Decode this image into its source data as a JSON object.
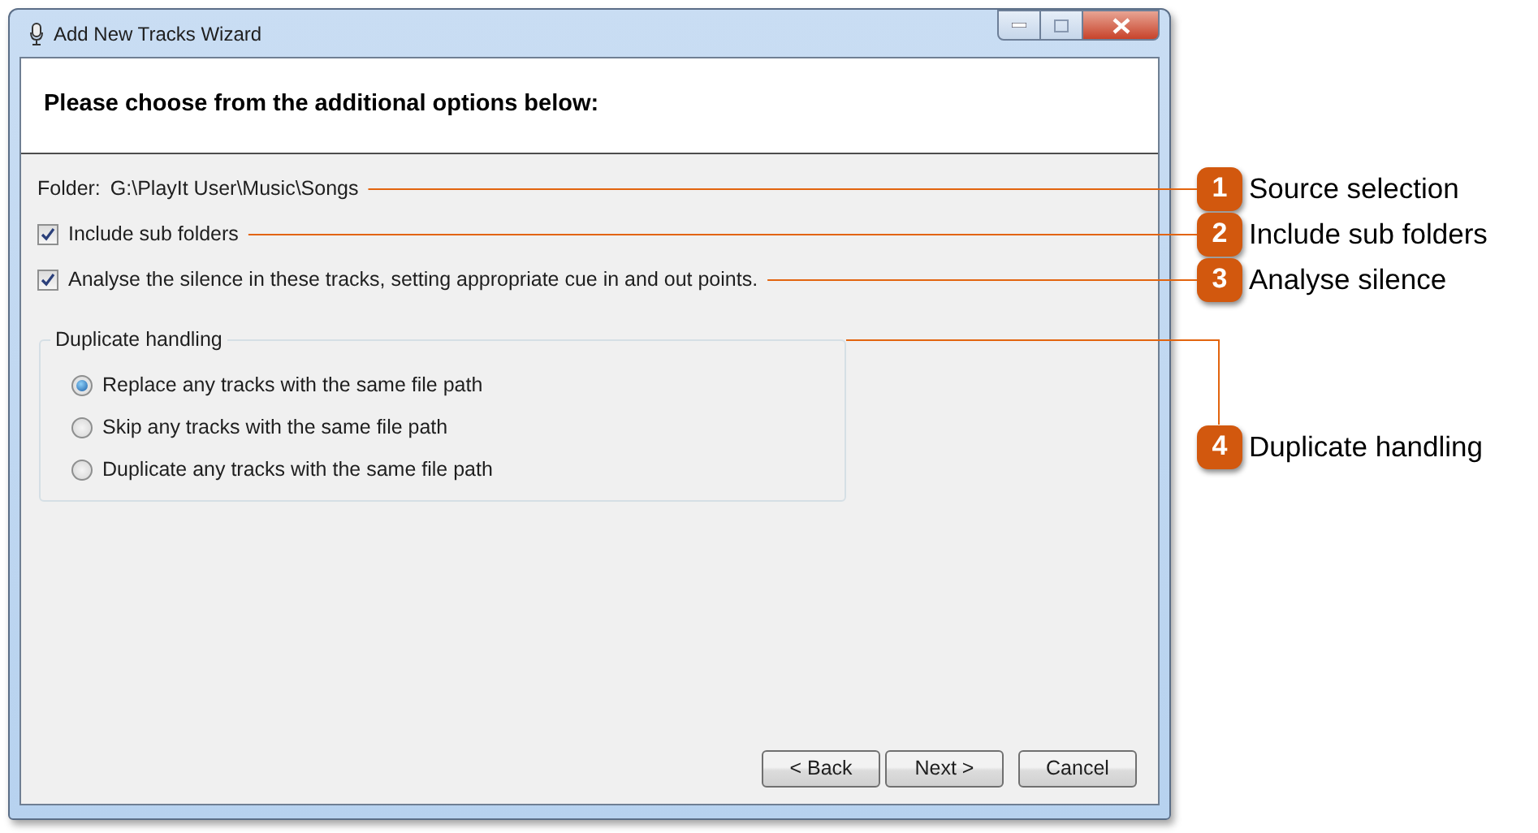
{
  "window": {
    "title": "Add New Tracks Wizard"
  },
  "header": {
    "title": "Please choose from the additional options below:"
  },
  "folder": {
    "label": "Folder:",
    "path": "G:\\PlayIt User\\Music\\Songs"
  },
  "checkboxes": [
    {
      "label": "Include sub folders",
      "checked": true
    },
    {
      "label": "Analyse the silence in these tracks, setting appropriate cue in and out points.",
      "checked": true
    }
  ],
  "duplicate_handling": {
    "title": "Duplicate handling",
    "options": [
      {
        "label": "Replace any tracks with the same file path",
        "selected": true
      },
      {
        "label": "Skip any tracks with the same file path",
        "selected": false
      },
      {
        "label": "Duplicate any tracks with the same file path",
        "selected": false
      }
    ]
  },
  "buttons": [
    {
      "label": "< Back"
    },
    {
      "label": "Next >"
    },
    {
      "label": "Cancel"
    }
  ],
  "callouts": [
    {
      "number": "1",
      "label": "Source selection"
    },
    {
      "number": "2",
      "label": "Include sub folders"
    },
    {
      "number": "3",
      "label": "Analyse silence"
    },
    {
      "number": "4",
      "label": "Duplicate handling"
    }
  ]
}
